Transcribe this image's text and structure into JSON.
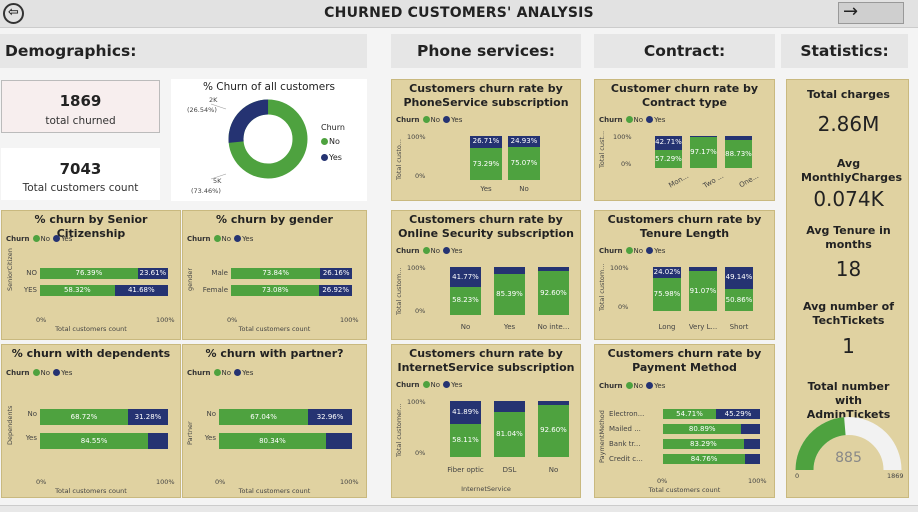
{
  "header": {
    "title": "CHURNED CUSTOMERS' ANALYSIS",
    "back_glyph": "⇦",
    "forward_glyph": "→"
  },
  "sections": {
    "demographics": "Demographics:",
    "phone": "Phone services:",
    "contract": "Contract:",
    "statistics": "Statistics:"
  },
  "kpis": {
    "churned_value": "1869",
    "churned_label": "total churned",
    "total_value": "7043",
    "total_label": "Total customers count"
  },
  "legend": {
    "title": "Churn",
    "no": "No",
    "yes": "Yes"
  },
  "colors": {
    "no": "#4ea23f",
    "yes": "#253372",
    "card": "#e0d2a1"
  },
  "donut": {
    "title": "% Churn of all customers",
    "yes_count": "2K",
    "yes_pct": "(26.54%)",
    "no_count": "5K",
    "no_pct": "(73.46%)",
    "yes_fraction": 0.2654
  },
  "hbar_charts": [
    {
      "title": "% churn by Senior Citizenship",
      "ylabel": "SeniorCitizen",
      "xlabel": "Total customers count",
      "xticks": [
        "0%",
        "100%"
      ],
      "rows": [
        {
          "label": "NO",
          "no": 76.39,
          "yes": 23.61,
          "no_text": "76.39%",
          "yes_text": "23.61%"
        },
        {
          "label": "YES",
          "no": 58.32,
          "yes": 41.68,
          "no_text": "58.32%",
          "yes_text": "41.68%"
        }
      ]
    },
    {
      "title": "% churn by gender",
      "ylabel": "gender",
      "xlabel": "Total customers count",
      "xticks": [
        "0%",
        "100%"
      ],
      "rows": [
        {
          "label": "Male",
          "no": 73.84,
          "yes": 26.16,
          "no_text": "73.84%",
          "yes_text": "26.16%"
        },
        {
          "label": "Female",
          "no": 73.08,
          "yes": 26.92,
          "no_text": "73.08%",
          "yes_text": "26.92%"
        }
      ]
    },
    {
      "title": "% churn with dependents",
      "ylabel": "Dependents",
      "xlabel": "Total customers count",
      "xticks": [
        "0%",
        "100%"
      ],
      "rows": [
        {
          "label": "No",
          "no": 68.72,
          "yes": 31.28,
          "no_text": "68.72%",
          "yes_text": "31.28%"
        },
        {
          "label": "Yes",
          "no": 84.55,
          "yes": 15.45,
          "no_text": "84.55%",
          "yes_text": ""
        }
      ]
    },
    {
      "title": "% churn with partner?",
      "ylabel": "Partner",
      "xlabel": "Total customers count",
      "xticks": [
        "0%",
        "100%"
      ],
      "rows": [
        {
          "label": "No",
          "no": 67.04,
          "yes": 32.96,
          "no_text": "67.04%",
          "yes_text": "32.96%"
        },
        {
          "label": "Yes",
          "no": 80.34,
          "yes": 19.66,
          "no_text": "80.34%",
          "yes_text": ""
        }
      ]
    }
  ],
  "vbar_charts": [
    {
      "title": "Customers churn rate by PhoneService subscription",
      "ylabel": "Total custo...",
      "yticks": [
        "100%",
        "0%"
      ],
      "xlabel": "",
      "cols": [
        {
          "label": "Yes",
          "no": 73.29,
          "yes": 26.71,
          "no_text": "73.29%",
          "yes_text": "26.71%"
        },
        {
          "label": "No",
          "no": 75.07,
          "yes": 24.93,
          "no_text": "75.07%",
          "yes_text": "24.93%"
        }
      ]
    },
    {
      "title": "Customers churn rate by Online Security subscription",
      "ylabel": "Total custom...",
      "yticks": [
        "100%",
        "0%"
      ],
      "xlabel": "",
      "cols": [
        {
          "label": "No",
          "no": 58.23,
          "yes": 41.77,
          "no_text": "58.23%",
          "yes_text": "41.77%"
        },
        {
          "label": "Yes",
          "no": 85.39,
          "yes": 14.61,
          "no_text": "85.39%",
          "yes_text": ""
        },
        {
          "label": "No inte...",
          "no": 92.6,
          "yes": 7.4,
          "no_text": "92.60%",
          "yes_text": ""
        }
      ]
    },
    {
      "title": "Customers churn rate by InternetService subscription",
      "ylabel": "Total customer...",
      "yticks": [
        "100%",
        "0%"
      ],
      "xlabel": "InternetService",
      "cols": [
        {
          "label": "Fiber optic",
          "no": 58.11,
          "yes": 41.89,
          "no_text": "58.11%",
          "yes_text": "41.89%"
        },
        {
          "label": "DSL",
          "no": 81.04,
          "yes": 18.96,
          "no_text": "81.04%",
          "yes_text": ""
        },
        {
          "label": "No",
          "no": 92.6,
          "yes": 7.4,
          "no_text": "92.60%",
          "yes_text": ""
        }
      ]
    },
    {
      "title": "Customer churn rate by Contract type",
      "ylabel": "Total cust...",
      "yticks": [
        "100%",
        "0%"
      ],
      "xlabel": "",
      "cols": [
        {
          "label": "Mon...",
          "no": 57.29,
          "yes": 42.71,
          "no_text": "57.29%",
          "yes_text": "42.71%"
        },
        {
          "label": "Two ...",
          "no": 97.17,
          "yes": 2.83,
          "no_text": "97.17%",
          "yes_text": ""
        },
        {
          "label": "One...",
          "no": 88.73,
          "yes": 11.27,
          "no_text": "88.73%",
          "yes_text": ""
        }
      ]
    },
    {
      "title": "Customers churn rate by Tenure Length",
      "ylabel": "Total custom...",
      "yticks": [
        "100%",
        "0%"
      ],
      "xlabel": "",
      "cols": [
        {
          "label": "Long",
          "no": 75.98,
          "yes": 24.02,
          "no_text": "75.98%",
          "yes_text": "24.02%"
        },
        {
          "label": "Very L...",
          "no": 91.07,
          "yes": 8.93,
          "no_text": "91.07%",
          "yes_text": ""
        },
        {
          "label": "Short",
          "no": 50.86,
          "yes": 49.14,
          "no_text": "50.86%",
          "yes_text": "49.14%"
        }
      ]
    }
  ],
  "payment_chart": {
    "title": "Customers churn rate by Payment Method",
    "ylabel": "PaymentMethod",
    "xlabel": "Total customers count",
    "xticks": [
      "0%",
      "100%"
    ],
    "rows": [
      {
        "label": "Electron...",
        "no": 54.71,
        "yes": 45.29,
        "no_text": "54.71%",
        "yes_text": "45.29%"
      },
      {
        "label": "Mailed ...",
        "no": 80.89,
        "yes": 19.11,
        "no_text": "80.89%",
        "yes_text": ""
      },
      {
        "label": "Bank tr...",
        "no": 83.29,
        "yes": 16.71,
        "no_text": "83.29%",
        "yes_text": ""
      },
      {
        "label": "Credit c...",
        "no": 84.76,
        "yes": 15.24,
        "no_text": "84.76%",
        "yes_text": ""
      }
    ]
  },
  "statistics": {
    "total_charges_label": "Total charges",
    "total_charges_value": "2.86M",
    "avg_monthly_label": "Avg MonthlyCharges",
    "avg_monthly_value": "0.074K",
    "avg_tenure_label": "Avg Tenure in months",
    "avg_tenure_value": "18",
    "avg_tech_label": "Avg number of TechTickets",
    "avg_tech_value": "1",
    "admin_label": "Total number with AdminTickets",
    "gauge_value": "885",
    "gauge_min": "0",
    "gauge_max": "1869",
    "gauge_fraction": 0.4735
  }
}
